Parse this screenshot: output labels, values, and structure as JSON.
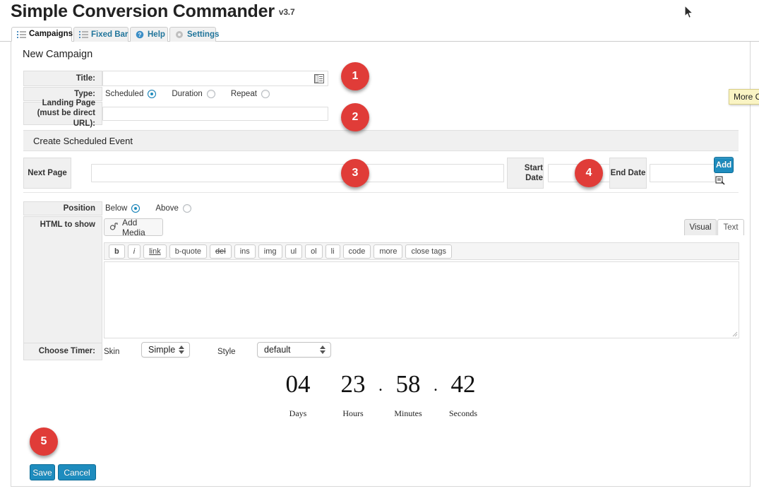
{
  "header": {
    "title": "Simple Conversion Commander",
    "version": "v3.7"
  },
  "tabs": [
    {
      "label": "Campaigns",
      "icon": "list-icon",
      "active": true
    },
    {
      "label": "Fixed Bar",
      "icon": "list-icon",
      "active": false
    },
    {
      "label": "Help",
      "icon": "help-icon",
      "active": false
    },
    {
      "label": "Settings",
      "icon": "gear-icon",
      "active": false
    }
  ],
  "panel": {
    "title": "New Campaign",
    "fields": {
      "title_label": "Title:",
      "title_value": "",
      "title_field_icon": "address-book-icon",
      "type_label": "Type:",
      "type_options": [
        {
          "label": "Scheduled",
          "selected": true
        },
        {
          "label": "Duration",
          "selected": false
        },
        {
          "label": "Repeat",
          "selected": false
        }
      ],
      "landing_label_line1": "Landing Page",
      "landing_label_line2": "(must be direct URL):",
      "landing_value": ""
    },
    "section": {
      "band_title": "Create Scheduled Event",
      "next_page_label": "Next Page",
      "next_page_value": "",
      "start_date_label": "Start Date",
      "start_date_value": "",
      "end_date_label": "End Date",
      "end_date_value": "",
      "add_label": "Add",
      "calendar_icon": "calendar-picker-icon"
    },
    "position": {
      "label": "Position",
      "options": [
        {
          "label": "Below",
          "selected": true
        },
        {
          "label": "Above",
          "selected": false
        }
      ]
    },
    "editor": {
      "label": "HTML to show",
      "add_media_label": "Add Media",
      "add_media_icon": "media-icon",
      "visual_tab": "Visual",
      "text_tab": "Text",
      "quicktags": [
        "b",
        "i",
        "link",
        "b-quote",
        "del",
        "ins",
        "img",
        "ul",
        "ol",
        "li",
        "code",
        "more",
        "close tags"
      ],
      "content": ""
    },
    "timer": {
      "label": "Choose Timer:",
      "skin_label": "Skin",
      "skin_value": "Simple",
      "style_label": "Style",
      "style_value": "default"
    },
    "countdown": {
      "days": "04",
      "hours": "23",
      "minutes": "58",
      "seconds": "42",
      "separator": ".",
      "days_label": "Days",
      "hours_label": "Hours",
      "minutes_label": "Minutes",
      "seconds_label": "Seconds"
    },
    "footer": {
      "save_label": "Save",
      "cancel_label": "Cancel"
    }
  },
  "callouts": [
    {
      "number": "1"
    },
    {
      "number": "2"
    },
    {
      "number": "3"
    },
    {
      "number": "4"
    },
    {
      "number": "5"
    }
  ],
  "tooltip": {
    "text": "More C"
  },
  "colors": {
    "badge_red": "#e03c38",
    "button_blue": "#1e8cbe",
    "tab_link": "#21759b",
    "tooltip_yellow": "#faf4c4"
  }
}
